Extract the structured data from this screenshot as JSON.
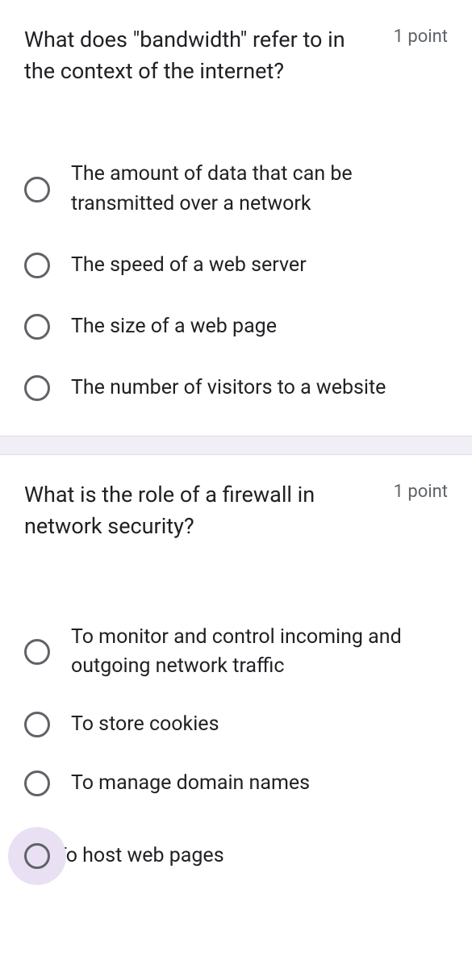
{
  "questions": [
    {
      "text": "What does \"bandwidth\" refer to in the context of the internet?",
      "points": "1 point",
      "options": [
        "The amount of data that can be transmitted over a network",
        "The speed of a web server",
        "The size of a web page",
        "The number of visitors to a website"
      ]
    },
    {
      "text": "What is the role of a firewall in network security?",
      "points": "1 point",
      "options": [
        "To monitor and control incoming and outgoing network traffic",
        "To store cookies",
        "To manage domain names",
        "To host web pages"
      ]
    }
  ]
}
